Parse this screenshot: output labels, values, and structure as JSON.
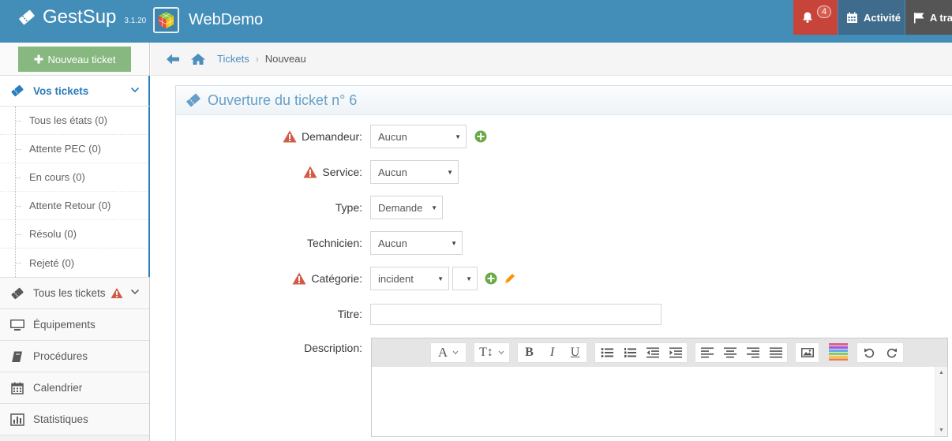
{
  "navbar": {
    "brand_name": "GestSup",
    "brand_version": "3.1.20",
    "site_name": "WebDemo",
    "notif_count": "4",
    "activity_label": "Activité",
    "atra_label": "A tra"
  },
  "sidebar": {
    "new_ticket_label": "Nouveau ticket",
    "vos_tickets_label": "Vos tickets",
    "sub_items": [
      {
        "label": "Tous les états (0)"
      },
      {
        "label": "Attente PEC (0)"
      },
      {
        "label": "En cours (0)"
      },
      {
        "label": "Attente Retour (0)"
      },
      {
        "label": "Résolu (0)"
      },
      {
        "label": "Rejeté (0)"
      }
    ],
    "items": [
      {
        "label": "Tous les tickets"
      },
      {
        "label": "Équipements"
      },
      {
        "label": "Procédures"
      },
      {
        "label": "Calendrier"
      },
      {
        "label": "Statistiques"
      }
    ]
  },
  "breadcrumb": {
    "tickets": "Tickets",
    "nouveau": "Nouveau"
  },
  "widget": {
    "title": "Ouverture du ticket n° 6"
  },
  "form": {
    "demandeur_label": "Demandeur:",
    "demandeur_value": "Aucun",
    "service_label": "Service:",
    "service_value": "Aucun",
    "type_label": "Type:",
    "type_value": "Demande",
    "technicien_label": "Technicien:",
    "technicien_value": "Aucun",
    "categorie_label": "Catégorie:",
    "categorie_value": "incident",
    "subcategorie_value": "",
    "titre_label": "Titre:",
    "titre_value": "",
    "description_label": "Description:"
  },
  "colors": {
    "navbar": "#438eb9",
    "accent": "#2b7dbc",
    "warning": "#d15b47",
    "success": "#69aa46",
    "edit": "#f89406"
  }
}
